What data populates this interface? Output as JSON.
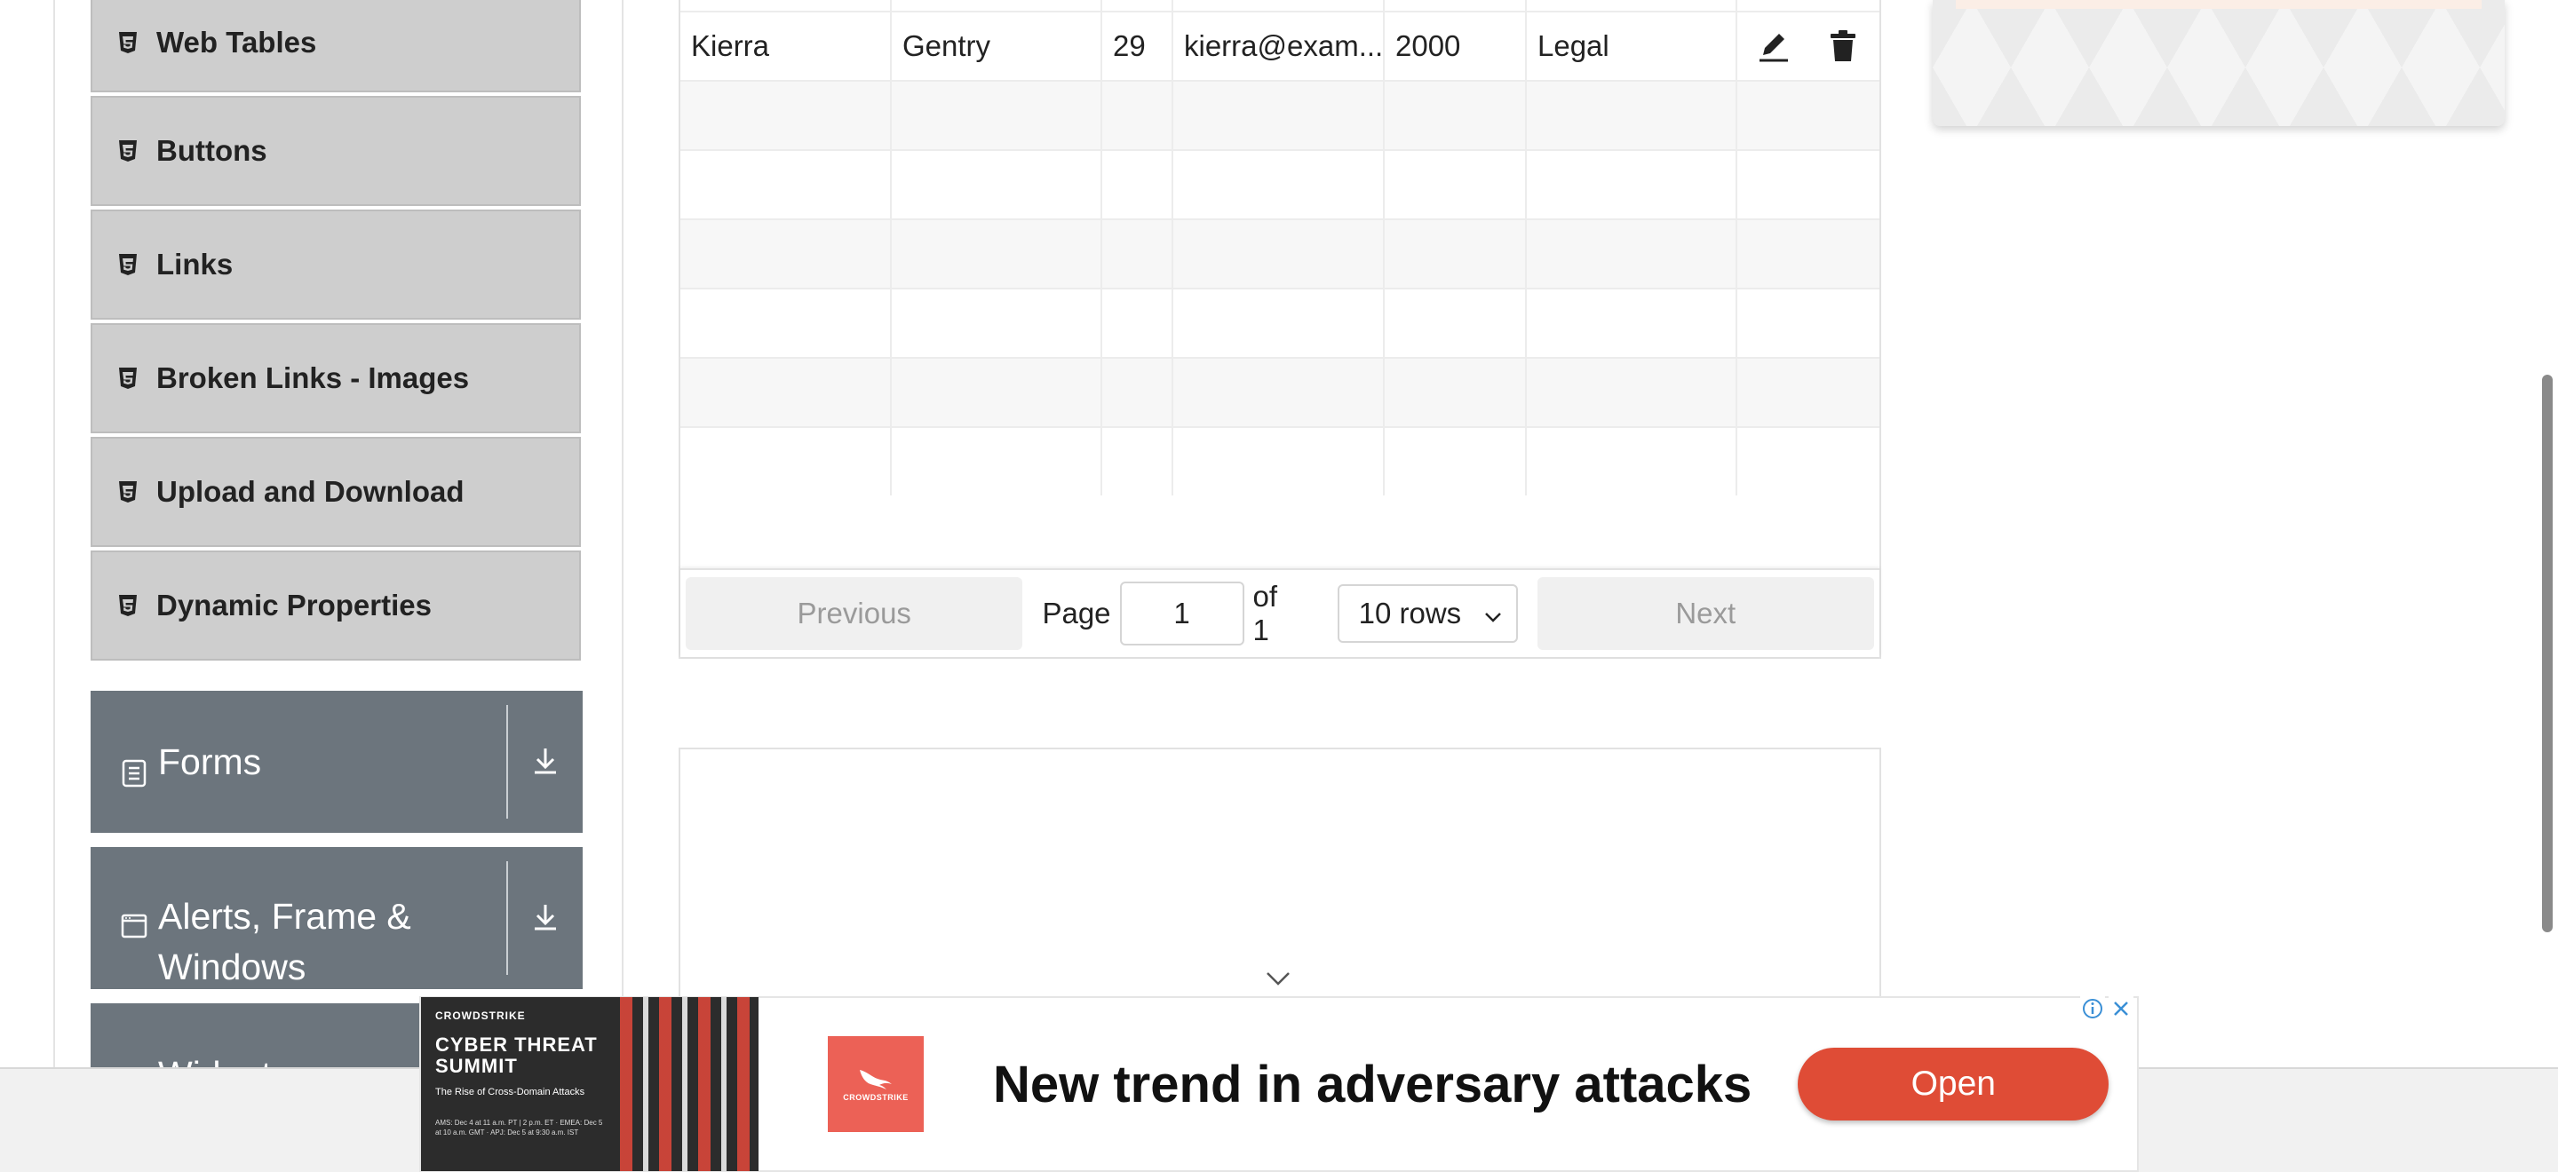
{
  "sidebar": {
    "items": [
      {
        "label": "Web Tables"
      },
      {
        "label": "Buttons"
      },
      {
        "label": "Links"
      },
      {
        "label": "Broken Links - Images"
      },
      {
        "label": "Upload and Download"
      },
      {
        "label": "Dynamic Properties"
      }
    ],
    "groups": [
      {
        "label": "Forms",
        "icon": "document-icon"
      },
      {
        "label": "Alerts, Frame & Windows",
        "icon": "window-icon"
      },
      {
        "label": "Widgets",
        "icon": "widgets-icon"
      }
    ]
  },
  "table": {
    "row": {
      "first_name": "Kierra",
      "last_name": "Gentry",
      "age": "29",
      "email": "kierra@exam...",
      "salary": "2000",
      "department": "Legal",
      "actions": [
        "edit-icon",
        "delete-icon"
      ]
    },
    "empty_rows": 7
  },
  "pagination": {
    "previous_label": "Previous",
    "page_label": "Page",
    "page_value": "1",
    "of_label": "of 1",
    "rows_select": "10 rows",
    "next_label": "Next"
  },
  "ad": {
    "brand": "CROWDSTRIKE",
    "left_title": "CYBER THREAT SUMMIT",
    "left_subtitle": "The Rise of Cross-Domain Attacks",
    "left_dates": "AMS: Dec 4 at 11 a.m. PT | 2 p.m. ET · EMEA: Dec 5 at 10 a.m. GMT · APJ: Dec 5 at 9:30 a.m. IST",
    "logo_text": "CROWDSTRIKE",
    "headline": "New trend in adversary attacks",
    "cta_label": "Open",
    "cta_color": "#df4c36"
  },
  "colors": {
    "sidebar_item_bg": "#cecece",
    "group_header_bg": "#6c757d"
  }
}
